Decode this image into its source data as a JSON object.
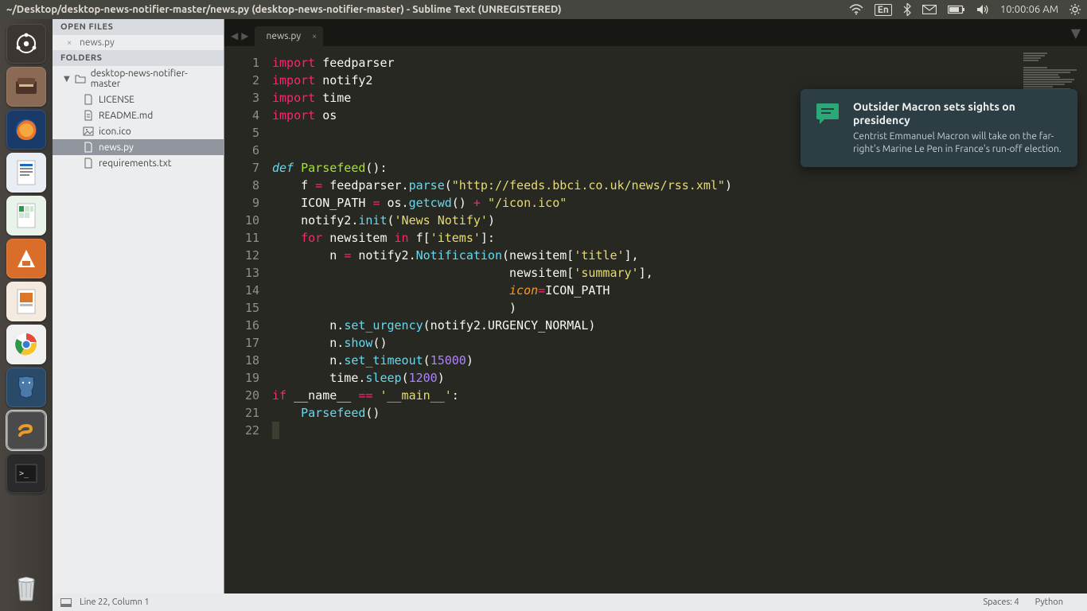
{
  "menubar": {
    "title": "~/Desktop/desktop-news-notifier-master/news.py (desktop-news-notifier-master) - Sublime Text (UNREGISTERED)",
    "input_lang": "En",
    "clock": "10:00:06 AM"
  },
  "sidebar": {
    "open_files_header": "OPEN FILES",
    "open_files": [
      {
        "label": "news.py"
      }
    ],
    "folders_header": "FOLDERS",
    "root_folder": "desktop-news-notifier-master",
    "files": [
      {
        "label": "LICENSE",
        "icon": "doc"
      },
      {
        "label": "README.md",
        "icon": "md"
      },
      {
        "label": "icon.ico",
        "icon": "img"
      },
      {
        "label": "news.py",
        "icon": "py",
        "active": true
      },
      {
        "label": "requirements.txt",
        "icon": "doc"
      }
    ]
  },
  "tabs": {
    "active": "news.py"
  },
  "code": {
    "line_numbers": [
      "1",
      "2",
      "3",
      "4",
      "5",
      "6",
      "7",
      "8",
      "9",
      "10",
      "11",
      "12",
      "13",
      "14",
      "15",
      "16",
      "17",
      "18",
      "19",
      "20",
      "21",
      "22"
    ]
  },
  "statusbar": {
    "position": "Line 22, Column 1",
    "spaces": "Spaces: 4",
    "syntax": "Python"
  },
  "notification": {
    "title": "Outsider Macron sets sights on presidency",
    "body": "Centrist Emmanuel Macron will take on the far-right's Marine Le Pen in France's run-off election."
  }
}
